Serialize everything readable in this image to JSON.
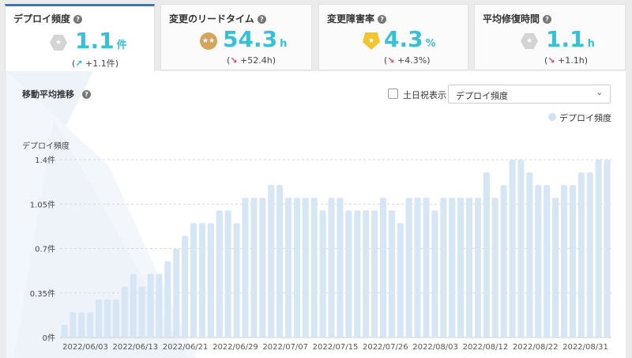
{
  "tabs": [
    {
      "title": "デプロイ頻度",
      "value": "1.1",
      "unit": "件",
      "medal": "gray",
      "arrow": "↗",
      "delta": "+1.1件",
      "dir": "up"
    },
    {
      "title": "変更のリードタイム",
      "value": "54.3",
      "unit": "h",
      "medal": "bronze",
      "arrow": "↘",
      "delta": "+52.4h",
      "dir": "down"
    },
    {
      "title": "変更障害率",
      "value": "4.3",
      "unit": "%",
      "medal": "gold",
      "arrow": "↘",
      "delta": "+4.3%",
      "dir": "down"
    },
    {
      "title": "平均修復時間",
      "value": "1.1",
      "unit": "h",
      "medal": "gray",
      "arrow": "↘",
      "delta": "+1.1h",
      "dir": "down"
    }
  ],
  "panel": {
    "title": "移動平均推移",
    "weekend_label": "土日祝表示",
    "select_value": "デプロイ頻度",
    "legend_label": "デプロイ頻度"
  },
  "colors": {
    "bar": "#d6e6f5",
    "accent": "#37c0d6",
    "tab_active": "#3f6fd0",
    "down": "#e0407a"
  },
  "chart_data": {
    "type": "bar",
    "ylabel": "デプロイ頻度",
    "ylim": [
      0,
      1.4
    ],
    "yticks": [
      0,
      0.35,
      0.7,
      1.05,
      1.4
    ],
    "ytick_labels": [
      "0件",
      "0.35件",
      "0.7件",
      "1.05件",
      "1.4件"
    ],
    "xtick_labels": [
      "2022/06/03",
      "2022/06/13",
      "2022/06/21",
      "2022/06/29",
      "2022/07/07",
      "2022/07/15",
      "2022/07/26",
      "2022/08/03",
      "2022/08/12",
      "2022/08/22",
      "2022/08/31"
    ],
    "series": [
      {
        "name": "デプロイ頻度",
        "values": [
          0.1,
          0.2,
          0.2,
          0.2,
          0.3,
          0.3,
          0.3,
          0.4,
          0.5,
          0.4,
          0.5,
          0.5,
          0.6,
          0.7,
          0.8,
          0.9,
          0.9,
          0.9,
          1.0,
          1.0,
          0.9,
          1.1,
          1.1,
          1.1,
          1.2,
          1.2,
          1.1,
          1.1,
          1.1,
          1.1,
          1.0,
          1.1,
          1.1,
          1.0,
          1.0,
          1.0,
          1.0,
          1.1,
          1.0,
          0.9,
          1.1,
          1.1,
          1.1,
          1.0,
          1.1,
          1.1,
          1.1,
          1.1,
          1.1,
          1.3,
          1.1,
          1.2,
          1.4,
          1.4,
          1.3,
          1.2,
          1.2,
          1.1,
          1.2,
          1.2,
          1.3,
          1.3,
          1.4,
          1.4
        ]
      }
    ]
  }
}
